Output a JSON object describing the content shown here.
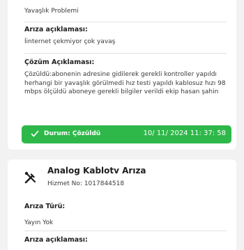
{
  "top_card": {
    "fault_title_value": "Yavaşlık Problemi",
    "fault_desc_label": "Arıza açıklaması:",
    "fault_desc_value": "İinternet çekmiyor çok yavaş",
    "solution_label": "Çözüm Açıklaması:",
    "solution_value": "Çözüldü:abonenin adresine gidilerek gerekli kontroller yapıldı herhangi bir yavaşlık görülmedi hız testi yapıldı kablosuz hızı 98 mbps ölçüldü aboneye gerekli bilgiler verildi ekip hasan şahin",
    "status_label": "Durum: Çözüldü",
    "status_time": "10/ 11/ 2024 11: 37: 58"
  },
  "bottom_card": {
    "service_title": "Analog Kablotv Arıza",
    "service_no": "Hizmet No: 1017844518",
    "fault_type_label": "Arıza Türü:",
    "fault_type_value": "Yayın Yok",
    "fault_desc_label": "Arıza açıklaması:"
  },
  "colors": {
    "status_green": "#2fb84a",
    "background": "#f2f2f2",
    "card": "#ffffff"
  },
  "icons": {
    "status": "check-icon",
    "service": "tools-icon"
  }
}
